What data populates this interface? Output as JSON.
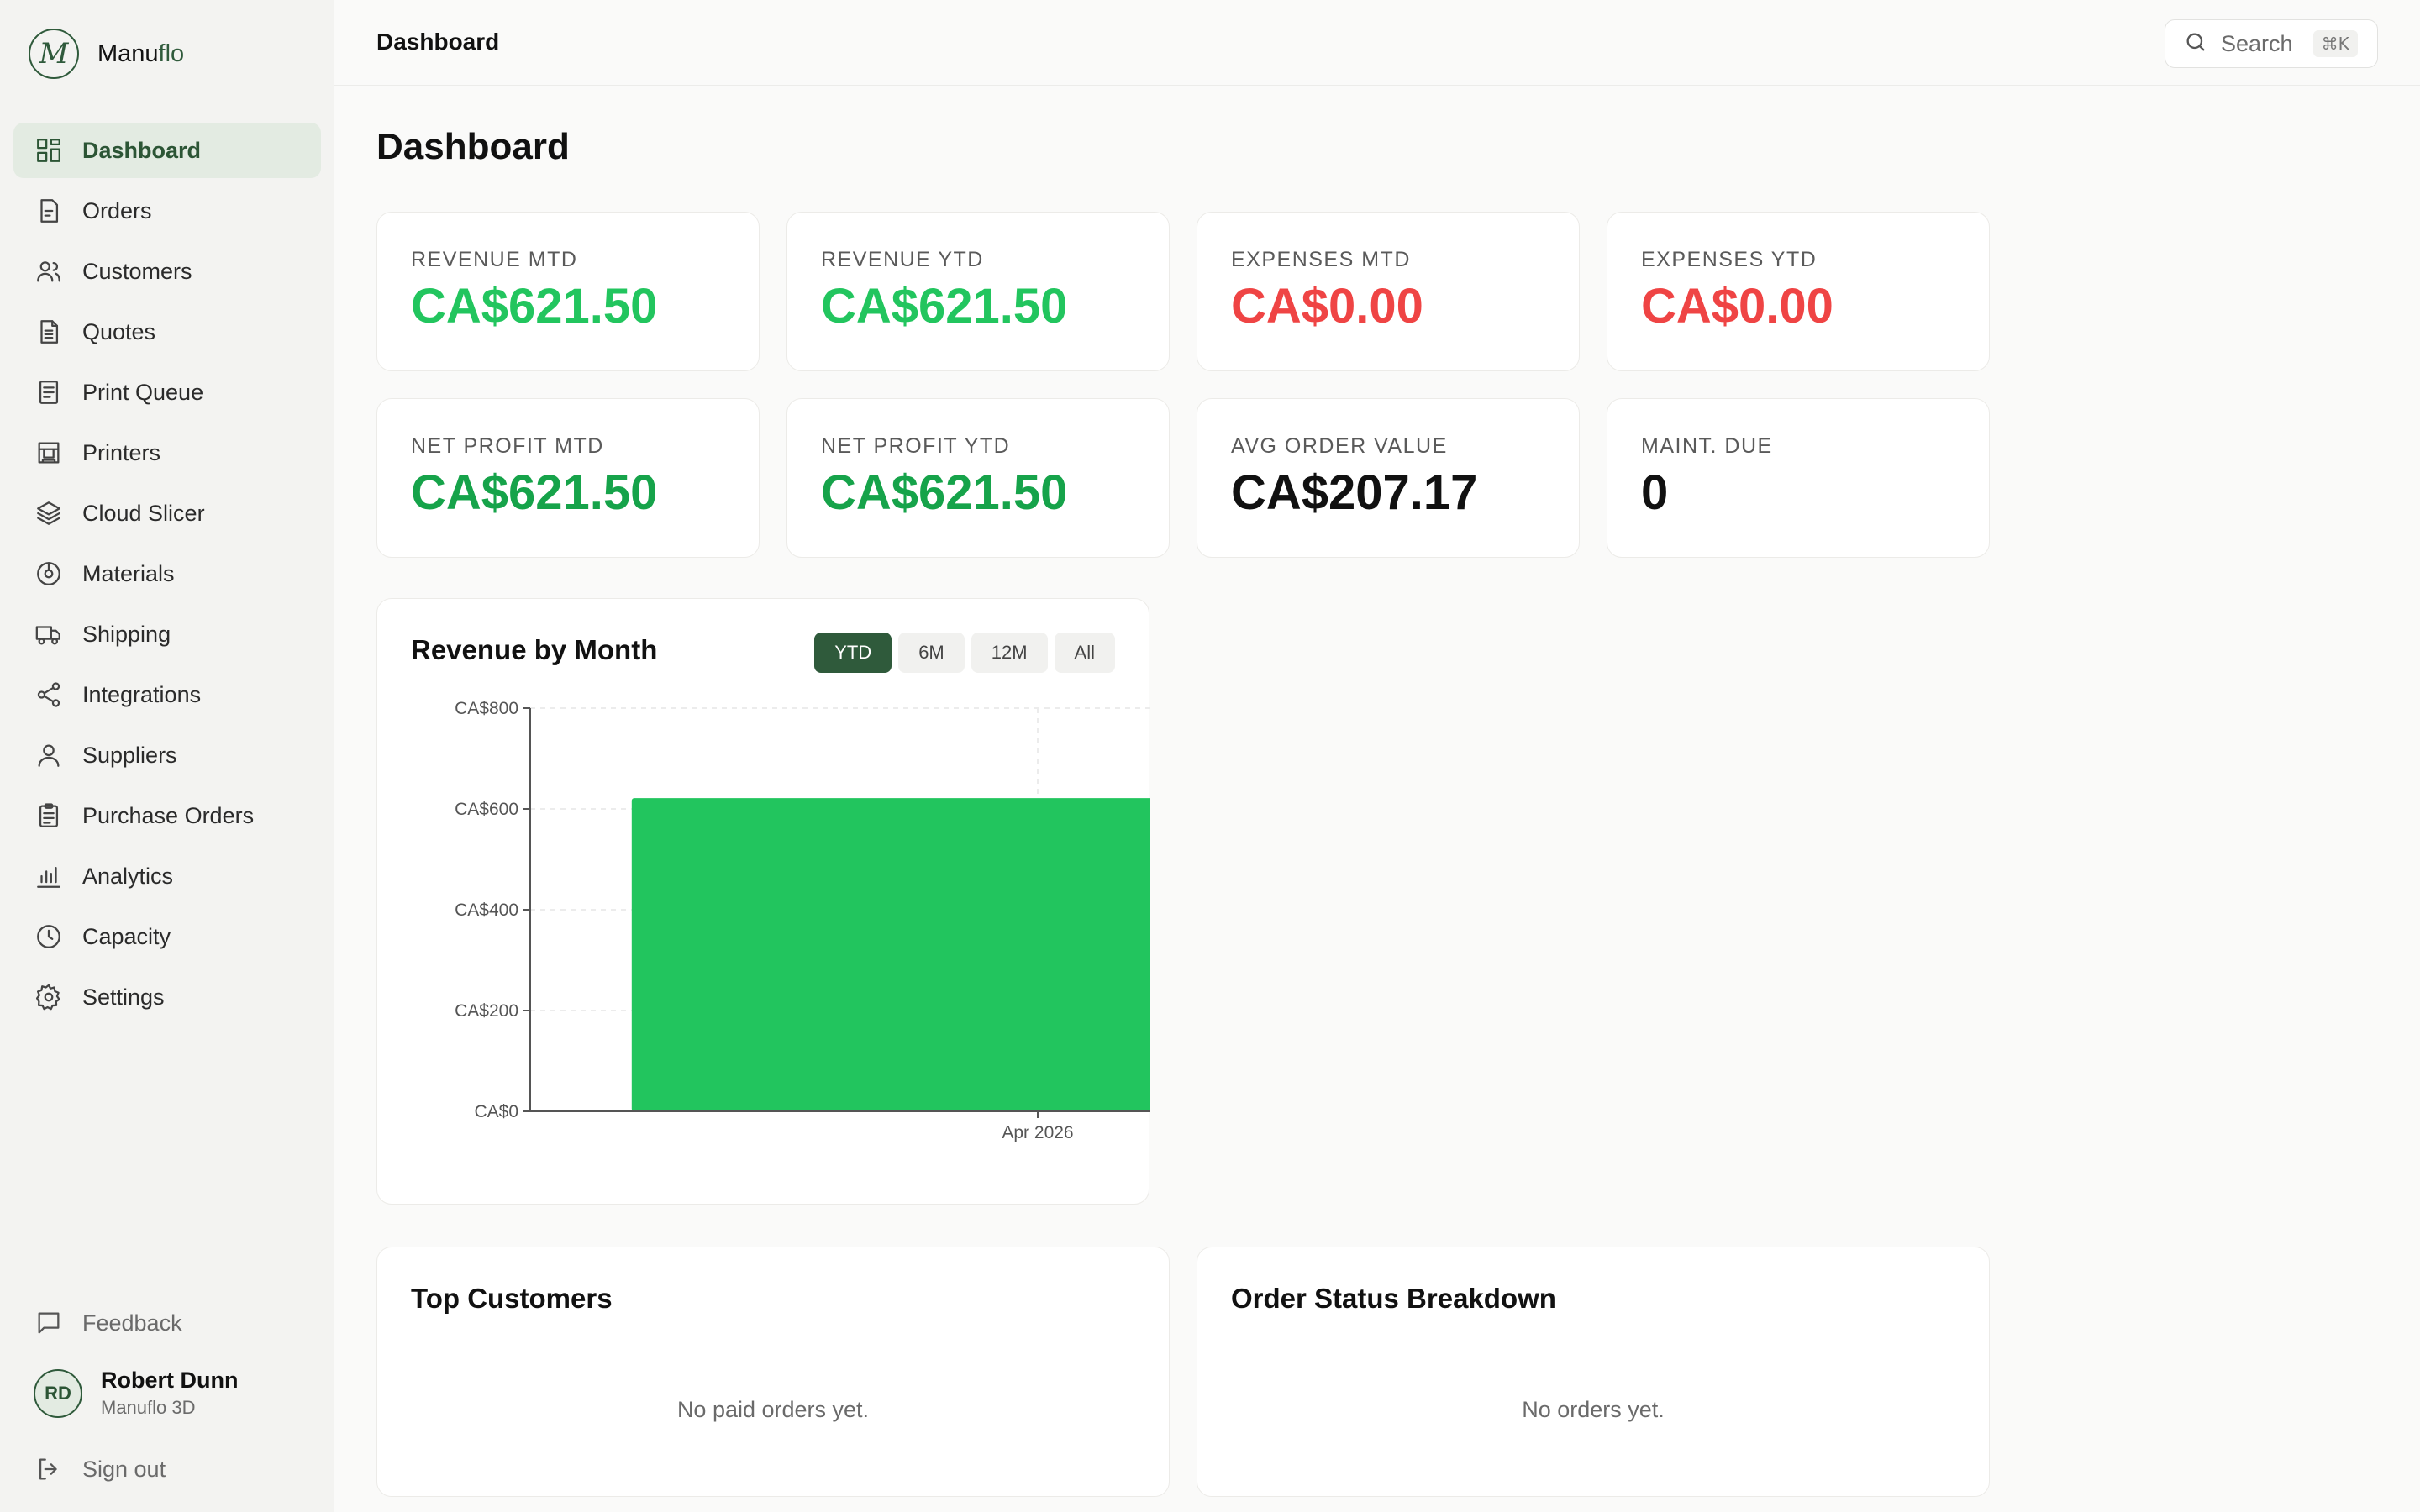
{
  "app": {
    "brand_first": "Manu",
    "brand_second": "flo",
    "logo_letter": "M"
  },
  "sidebar": {
    "items": [
      {
        "label": "Dashboard",
        "icon": "grid-icon",
        "active": true
      },
      {
        "label": "Orders",
        "icon": "file-icon"
      },
      {
        "label": "Customers",
        "icon": "users-icon"
      },
      {
        "label": "Quotes",
        "icon": "document-icon"
      },
      {
        "label": "Print Queue",
        "icon": "list-doc-icon"
      },
      {
        "label": "Printers",
        "icon": "printer-icon"
      },
      {
        "label": "Cloud Slicer",
        "icon": "layers-icon"
      },
      {
        "label": "Materials",
        "icon": "spool-icon"
      },
      {
        "label": "Shipping",
        "icon": "truck-icon"
      },
      {
        "label": "Integrations",
        "icon": "share-icon"
      },
      {
        "label": "Suppliers",
        "icon": "user-icon"
      },
      {
        "label": "Purchase Orders",
        "icon": "clipboard-icon"
      },
      {
        "label": "Analytics",
        "icon": "bar-chart-icon"
      },
      {
        "label": "Capacity",
        "icon": "clock-icon"
      },
      {
        "label": "Settings",
        "icon": "gear-icon"
      }
    ],
    "feedback_label": "Feedback",
    "user": {
      "initials": "RD",
      "name": "Robert Dunn",
      "org": "Manuflo 3D"
    },
    "signout_label": "Sign out"
  },
  "topbar": {
    "title": "Dashboard",
    "search_label": "Search",
    "search_shortcut": "⌘K"
  },
  "page": {
    "title": "Dashboard"
  },
  "stats": [
    {
      "label": "REVENUE MTD",
      "value": "CA$621.50",
      "color": "#22c55e"
    },
    {
      "label": "REVENUE YTD",
      "value": "CA$621.50",
      "color": "#22c55e"
    },
    {
      "label": "EXPENSES MTD",
      "value": "CA$0.00",
      "color": "#ef4444"
    },
    {
      "label": "EXPENSES YTD",
      "value": "CA$0.00",
      "color": "#ef4444"
    },
    {
      "label": "NET PROFIT MTD",
      "value": "CA$621.50",
      "color": "#16a34a"
    },
    {
      "label": "NET PROFIT YTD",
      "value": "CA$621.50",
      "color": "#16a34a"
    },
    {
      "label": "AVG ORDER VALUE",
      "value": "CA$207.17",
      "color": "#111111"
    },
    {
      "label": "MAINT. DUE",
      "value": "0",
      "color": "#111111"
    }
  ],
  "revenue_panel": {
    "title": "Revenue by Month",
    "ranges": [
      "YTD",
      "6M",
      "12M",
      "All"
    ],
    "active_range": "YTD"
  },
  "chart_data": {
    "type": "bar",
    "title": "Revenue by Month",
    "categories": [
      "Apr 2026"
    ],
    "values": [
      621.5
    ],
    "ylim": [
      0,
      800
    ],
    "yticks": [
      0,
      200,
      400,
      600,
      800
    ],
    "ytick_labels": [
      "CA$0",
      "CA$200",
      "CA$400",
      "CA$600",
      "CA$800"
    ],
    "bar_color": "#22c55e",
    "grid": true
  },
  "top_customers": {
    "title": "Top Customers",
    "empty": "No paid orders yet."
  },
  "order_status": {
    "title": "Order Status Breakdown",
    "empty": "No orders yet."
  }
}
